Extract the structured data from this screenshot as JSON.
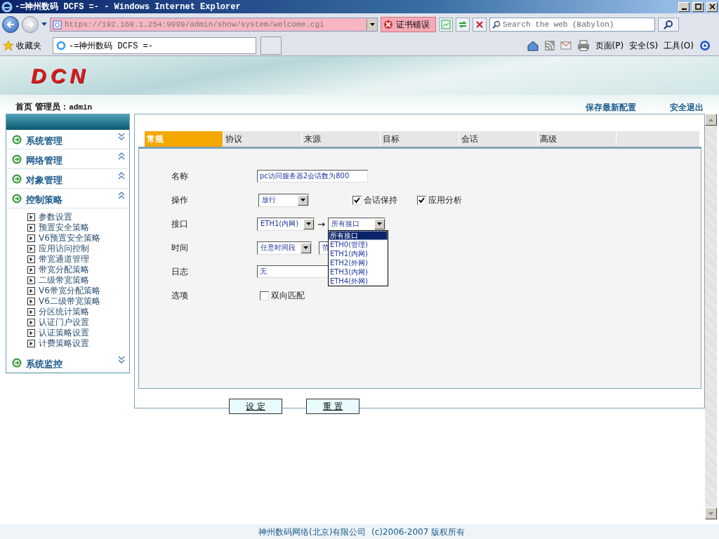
{
  "browser": {
    "title": "-=神州数码 DCFS =- - Windows Internet Explorer",
    "url": "https://192.168.1.254:9999/admin/show/system/welcome.cgi",
    "cert_error": "证书错误",
    "search_placeholder": "Search the web (Babylon)",
    "favorites": "收藏夹",
    "tab_title": "-=神州数码 DCFS =-",
    "commands": [
      "页面(P)",
      "安全(S)",
      "工具(O)"
    ]
  },
  "header": {
    "logo": "DCN",
    "home": "首页",
    "admin_label": "管理员：",
    "admin_name": "admin",
    "actions": [
      "保存最新配置",
      "安全退出"
    ]
  },
  "sidebar": [
    {
      "label": "系统管理",
      "expanded": false
    },
    {
      "label": "网络管理",
      "expanded": true
    },
    {
      "label": "对象管理",
      "expanded": true
    },
    {
      "label": "控制策略",
      "expanded": true,
      "children": [
        {
          "label": "参数设置"
        },
        {
          "label": "预置安全策略"
        },
        {
          "label": "V6预置安全策略"
        },
        {
          "label": "应用访问控制"
        },
        {
          "label": "带宽通道管理"
        },
        {
          "label": "带宽分配策略"
        },
        {
          "label": "二级带宽策略"
        },
        {
          "label": "V6带宽分配策略"
        },
        {
          "label": "V6二级带宽策略"
        },
        {
          "label": "分区统计策略"
        },
        {
          "label": "认证门户设置"
        },
        {
          "label": "认证策略设置"
        },
        {
          "label": "计费策略设置"
        }
      ]
    },
    {
      "label": "系统监控",
      "expanded": false
    }
  ],
  "tabs": [
    {
      "label": "常规",
      "selected": true
    },
    {
      "label": "协议",
      "selected": false
    },
    {
      "label": "来源",
      "selected": false
    },
    {
      "label": "目标",
      "selected": false
    },
    {
      "label": "会话",
      "selected": false
    },
    {
      "label": "高级",
      "selected": false
    }
  ],
  "form": {
    "name": {
      "label": "名称",
      "value": "pc访问服务器2会话数为800"
    },
    "action": {
      "label": "操作",
      "value": "放行"
    },
    "session_keep": {
      "label": "会话保持",
      "checked": true
    },
    "app_analysis": {
      "label": "应用分析",
      "checked": true
    },
    "interface": {
      "label": "接口",
      "from": "ETH1(内网)",
      "arrow": "→",
      "to": "所有接口",
      "options": [
        {
          "label": "所有接口",
          "selected": true
        },
        {
          "label": "ETH0(管理)",
          "selected": false
        },
        {
          "label": "ETH1(内网)",
          "selected": false
        },
        {
          "label": "ETH2(外网)",
          "selected": false
        },
        {
          "label": "ETH3(内网)",
          "selected": false
        },
        {
          "label": "ETH4(外网)",
          "selected": false
        }
      ]
    },
    "time": {
      "label": "时间",
      "value": "任意时间段",
      "value_2": "范"
    },
    "log": {
      "label": "日志",
      "value": "无"
    },
    "options": {
      "label": "选项",
      "bidirectional": {
        "label": "双向匹配",
        "checked": false
      }
    }
  },
  "buttons": [
    "设 定",
    "重 置"
  ],
  "footer": "神州数码网络(北京)有限公司  (c)2006-2007 版权所有"
}
